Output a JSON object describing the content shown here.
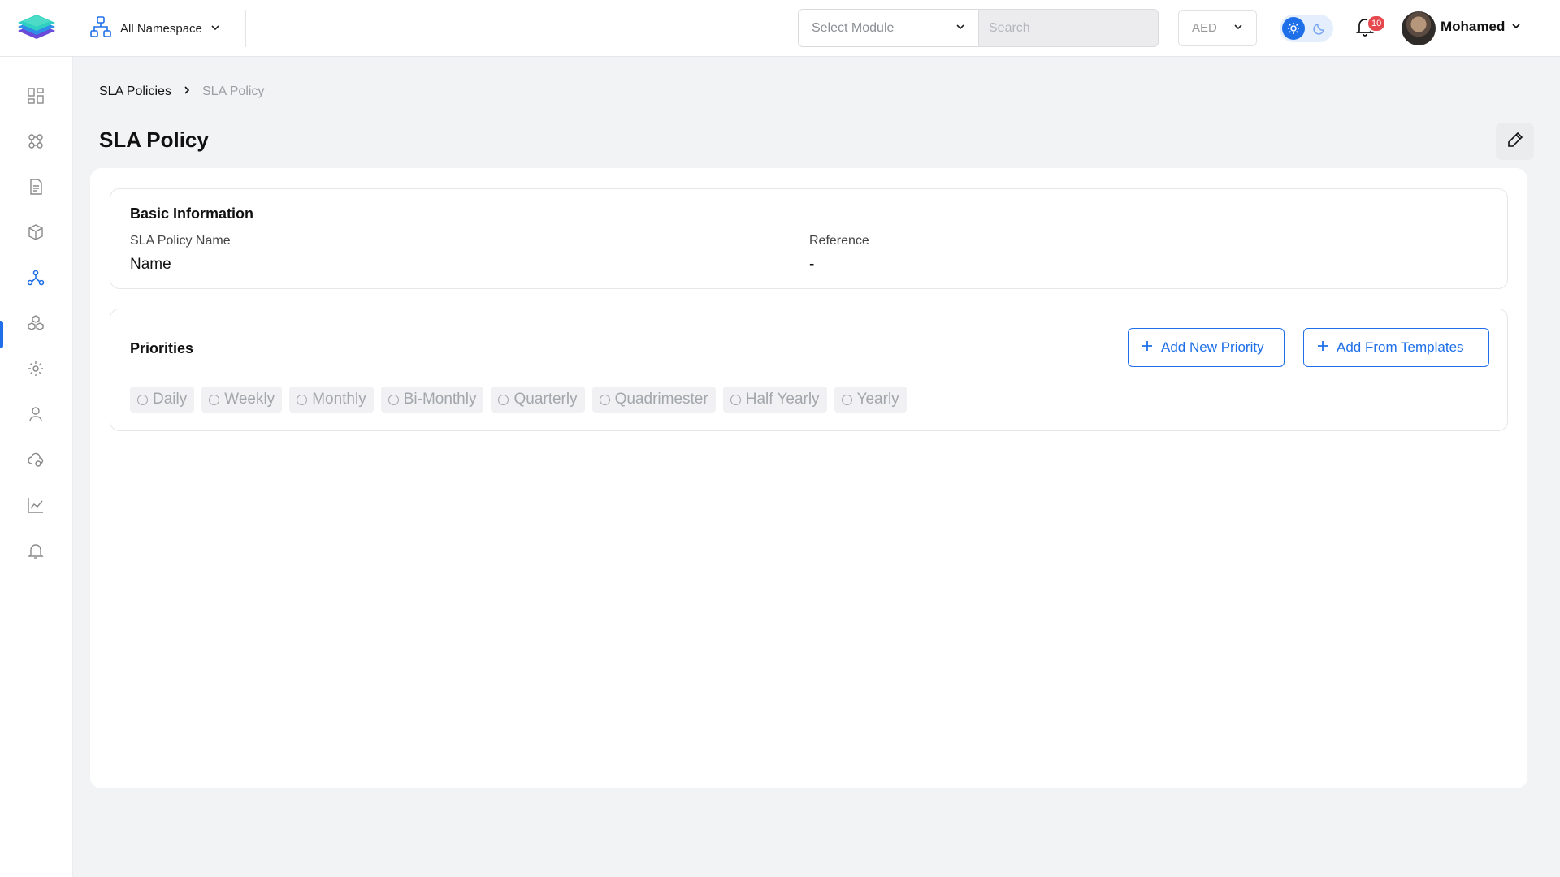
{
  "topbar": {
    "namespace_label": "All Namespace",
    "module_placeholder": "Select Module",
    "search_placeholder": "Search",
    "currency": "AED",
    "notification_count": "10",
    "user_name": "Mohamed"
  },
  "sidebar": {
    "items": [
      {
        "icon": "dashboard-grid-icon",
        "active": false
      },
      {
        "icon": "integrations-icon",
        "active": false
      },
      {
        "icon": "reports-document-icon",
        "active": false
      },
      {
        "icon": "package-box-icon",
        "active": false
      },
      {
        "icon": "network-nodes-icon",
        "active": true
      },
      {
        "icon": "cubes-icon",
        "active": false
      },
      {
        "icon": "settings-gear-icon",
        "active": false
      },
      {
        "icon": "user-icon",
        "active": false
      },
      {
        "icon": "cloud-settings-icon",
        "active": false
      },
      {
        "icon": "analytics-chart-icon",
        "active": false
      },
      {
        "icon": "notifications-bell-icon",
        "active": false
      }
    ]
  },
  "breadcrumb": {
    "parent": "SLA Policies",
    "current": "SLA Policy"
  },
  "page": {
    "title": "SLA Policy"
  },
  "basic_info": {
    "title": "Basic Information",
    "policy_name_label": "SLA Policy Name",
    "policy_name_value": "Name",
    "reference_label": "Reference",
    "reference_value": "-"
  },
  "priorities": {
    "title": "Priorities",
    "add_new_label": "Add New Priority",
    "add_templates_label": "Add From Templates",
    "options": [
      "Daily",
      "Weekly",
      "Monthly",
      "Bi-Monthly",
      "Quarterly",
      "Quadrimester",
      "Half Yearly",
      "Yearly"
    ]
  },
  "colors": {
    "accent": "#1e6fe8",
    "badge": "#e5484d",
    "background": "#f2f3f5"
  }
}
